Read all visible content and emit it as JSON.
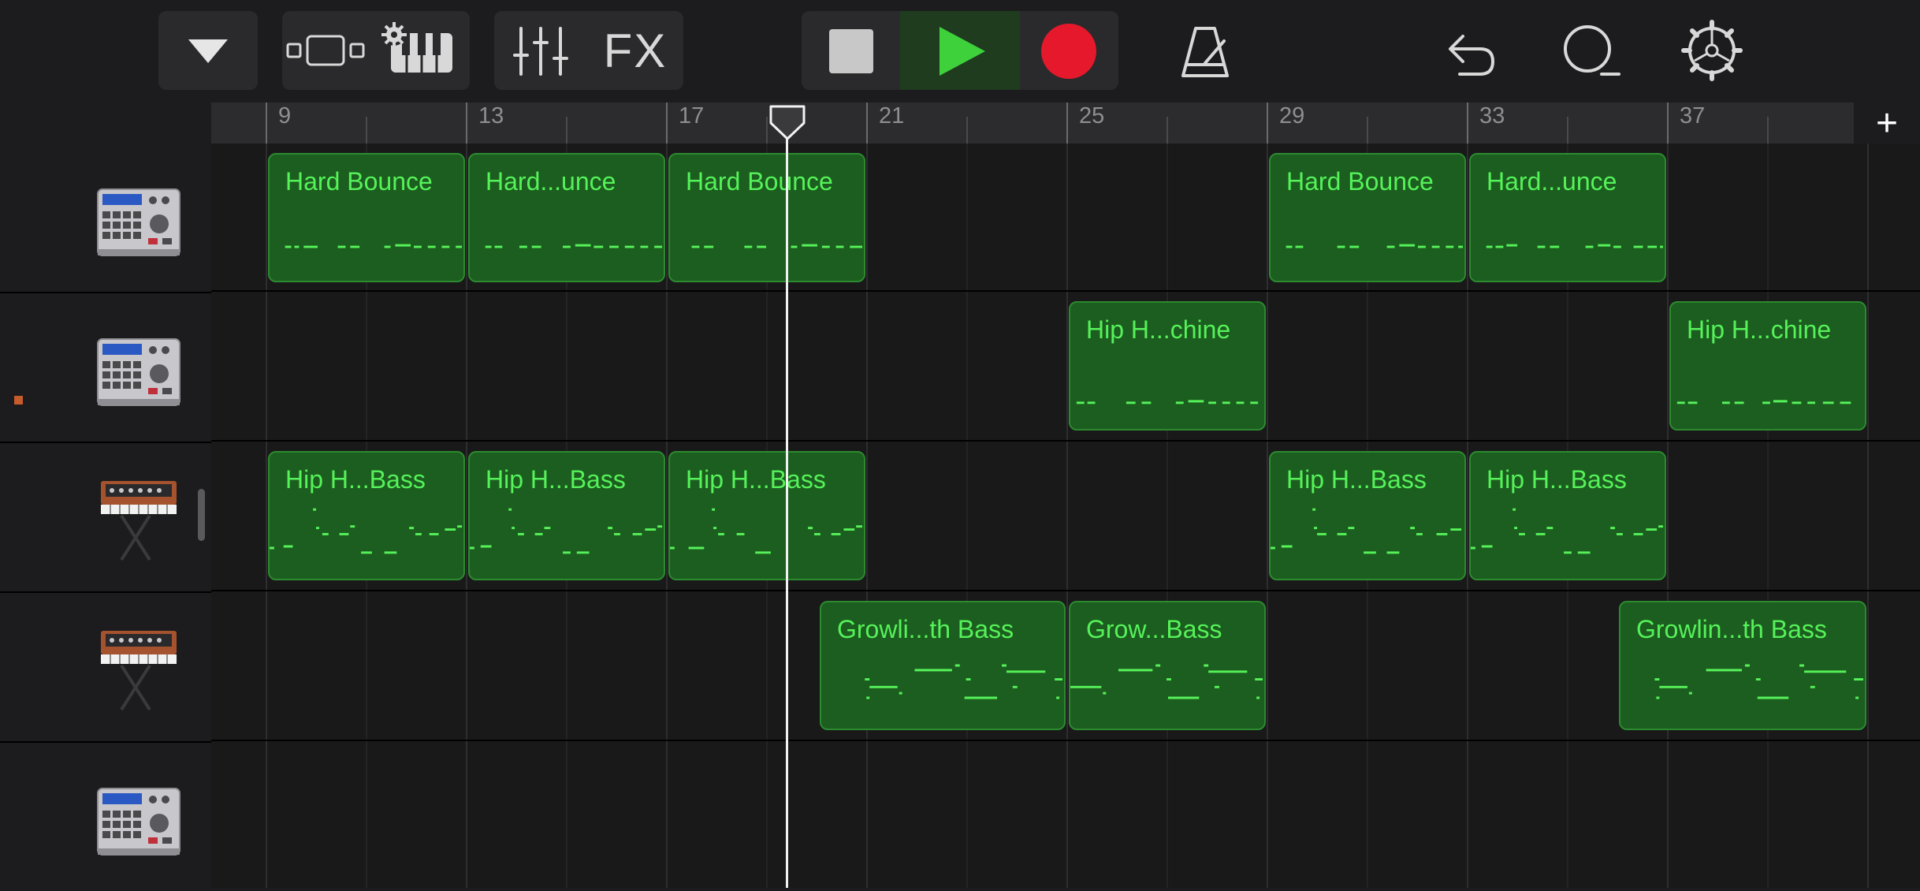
{
  "toolbar": {
    "fx_label": "FX"
  },
  "ruler": {
    "bar_numbers": [
      "9",
      "13",
      "17",
      "21",
      "25",
      "29",
      "33",
      "37"
    ],
    "add_track_label": "+"
  },
  "tracks": [
    {
      "instrument": "drum-machine",
      "selected": true
    },
    {
      "instrument": "drum-machine",
      "selected": false
    },
    {
      "instrument": "synthesizer",
      "selected": false
    },
    {
      "instrument": "synthesizer",
      "selected": false
    },
    {
      "instrument": "drum-machine",
      "selected": false
    }
  ],
  "regions": {
    "track1": [
      "Hard Bounce",
      "Hard...unce",
      "Hard Bounce",
      "Hard Bounce",
      "Hard...unce"
    ],
    "track2": [
      "Hip H...chine",
      "Hip H...chine"
    ],
    "track3": [
      "Hip H...Bass",
      "Hip H...Bass",
      "Hip H...Bass",
      "Hip H...Bass",
      "Hip H...Bass"
    ],
    "track4": [
      "Growli...th Bass",
      "Grow...Bass",
      "Growlin...th Bass"
    ]
  },
  "colors": {
    "region_fill": "#1c5e1f",
    "region_text": "#56f25a",
    "play": "#3fd13b",
    "record": "#e5192b"
  }
}
